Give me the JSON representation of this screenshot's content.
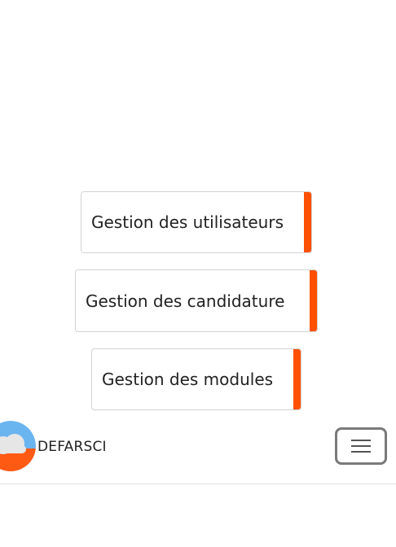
{
  "menu_cards": [
    {
      "label": "Gestion des utilisateurs"
    },
    {
      "label": "Gestion des candidature"
    },
    {
      "label": "Gestion des modules"
    }
  ],
  "navbar": {
    "brand": "DEFARSCI",
    "logo_icon": "cloud-logo-icon",
    "toggler_icon": "hamburger-menu-icon"
  },
  "colors": {
    "accent": "#ff5000",
    "logo_blue": "#6ab4f0",
    "logo_orange": "#ff5a14"
  }
}
